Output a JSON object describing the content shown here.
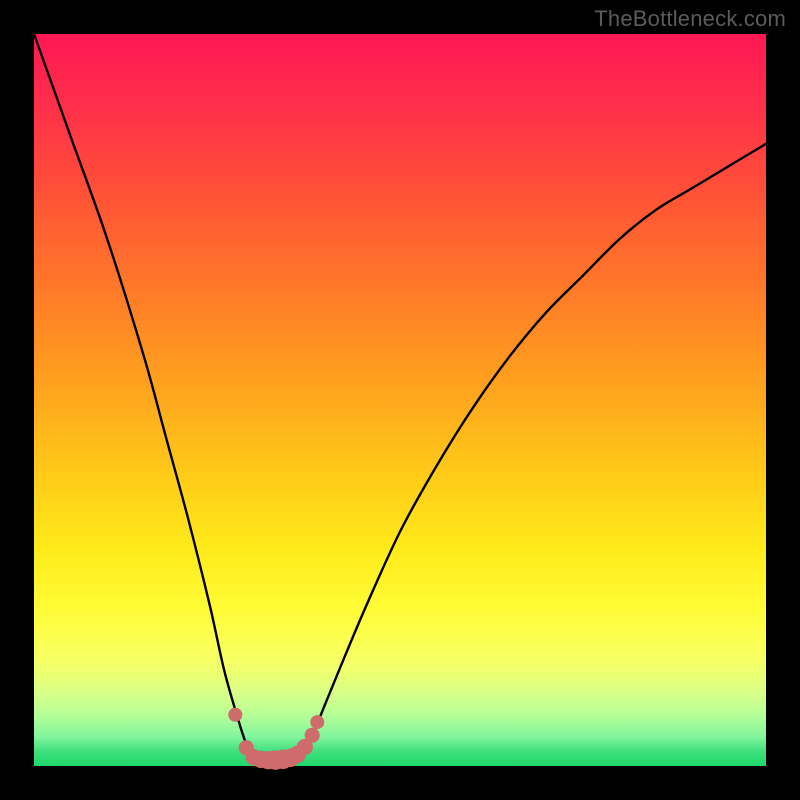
{
  "watermark": "TheBottleneck.com",
  "chart_data": {
    "type": "line",
    "title": "",
    "xlabel": "",
    "ylabel": "",
    "xlim": [
      0,
      100
    ],
    "ylim": [
      0,
      100
    ],
    "grid": false,
    "background_gradient": {
      "direction": "vertical",
      "stops": [
        {
          "pos": 0.0,
          "color": "#ff1854"
        },
        {
          "pos": 0.35,
          "color": "#ff7a28"
        },
        {
          "pos": 0.7,
          "color": "#ffe91a"
        },
        {
          "pos": 0.93,
          "color": "#b6ff97"
        },
        {
          "pos": 1.0,
          "color": "#1fd86b"
        }
      ]
    },
    "series": [
      {
        "name": "bottleneck-curve",
        "color": "#000000",
        "x": [
          0,
          5,
          10,
          15,
          18,
          21,
          24,
          26,
          28,
          29,
          30,
          31,
          33,
          35,
          37,
          38,
          40,
          45,
          50,
          55,
          60,
          65,
          70,
          75,
          80,
          85,
          90,
          95,
          100
        ],
        "y": [
          100,
          86,
          72,
          56,
          45,
          34,
          22,
          13,
          6,
          3,
          1,
          1,
          1,
          1,
          2,
          4,
          9,
          21,
          32,
          41,
          49,
          56,
          62,
          67,
          72,
          76,
          79,
          82,
          85
        ]
      },
      {
        "name": "highlight-dots",
        "color": "#cf6b6b",
        "type": "scatter",
        "x": [
          27.5,
          29.0,
          30.0,
          31.0,
          32.0,
          33.0,
          34.0,
          35.0,
          36.0,
          37.0,
          38.0,
          38.7
        ],
        "y": [
          7.0,
          2.5,
          1.2,
          0.9,
          0.8,
          0.8,
          0.9,
          1.1,
          1.6,
          2.6,
          4.2,
          6.0
        ]
      }
    ]
  }
}
